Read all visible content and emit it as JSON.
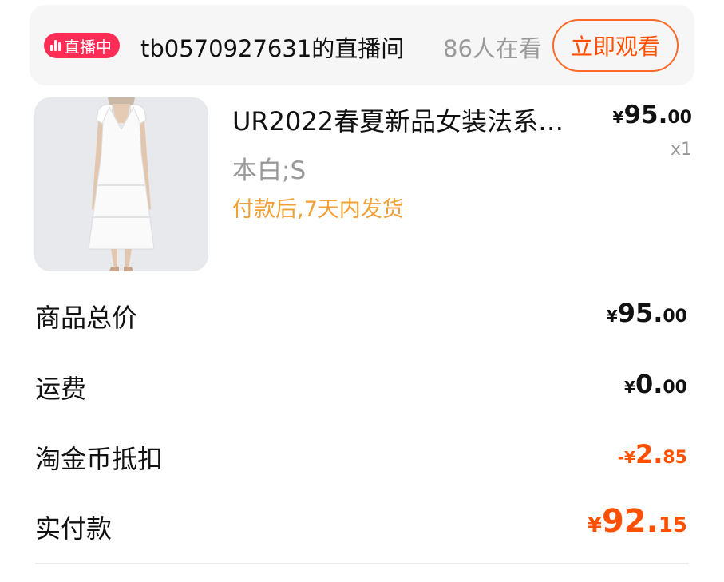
{
  "live": {
    "badge": "直播中",
    "room_name": "tb0570927631的直播间",
    "viewers": "86人在看",
    "watch_label": "立即观看"
  },
  "item": {
    "title": "UR2022春夏新品女装法系…",
    "sku": "本白;S",
    "shipping": "付款后,7天内发货",
    "price_currency": "¥",
    "price_int": "95.",
    "price_dec": "00",
    "quantity": "x1"
  },
  "summary": {
    "subtotal_label": "商品总价",
    "subtotal_cur": "¥",
    "subtotal_int": "95.",
    "subtotal_dec": "00",
    "shipping_label": "运费",
    "shipping_cur": "¥",
    "shipping_int": "0.",
    "shipping_dec": "00",
    "coin_label": "淘金币抵扣",
    "coin_cur": "-¥",
    "coin_int": "2.",
    "coin_dec": "85",
    "paid_label": "实付款",
    "paid_cur": "¥",
    "paid_int": "92.",
    "paid_dec": "15"
  },
  "colors": {
    "accent": "#ff5000",
    "live_badge": "#ff2d55",
    "shipping_text": "#f0a034"
  }
}
